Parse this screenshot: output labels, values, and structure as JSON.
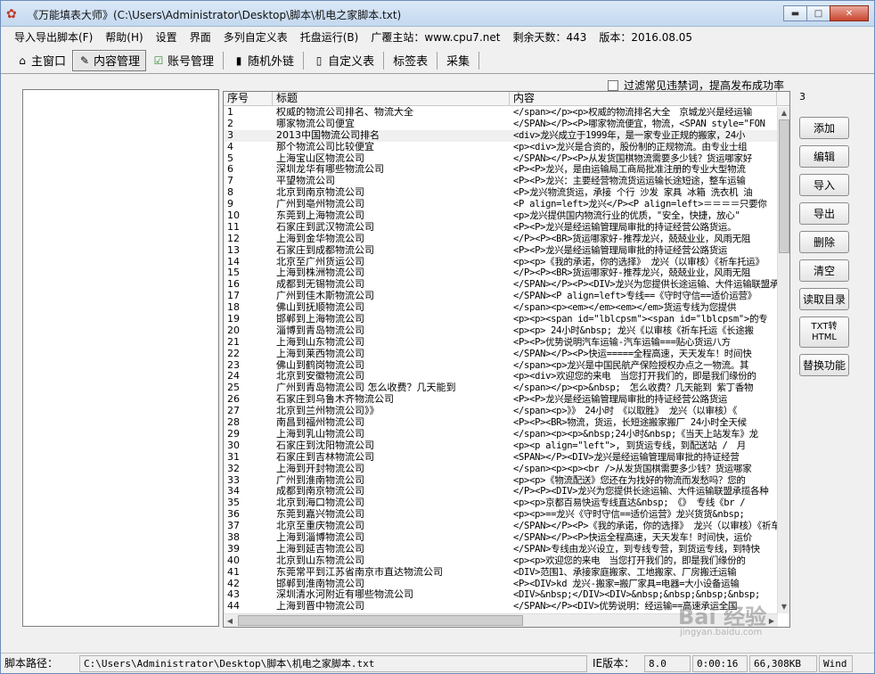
{
  "window": {
    "title": "《万能填表大师》(C:\\Users\\Administrator\\Desktop\\脚本\\机电之家脚本.txt)"
  },
  "menu": [
    "导入导出脚本(F)",
    "帮助(H)",
    "设置",
    "界面",
    "多列自定义表",
    "托盘运行(B)",
    "广覆主站：www.cpu7.net",
    "剩余天数：443",
    "版本：2016.08.05"
  ],
  "tabs": [
    {
      "label": "主窗口",
      "icon": "home-icon"
    },
    {
      "label": "内容管理",
      "icon": "notepad-icon",
      "active": true
    },
    {
      "label": "账号管理",
      "icon": "check-icon"
    },
    {
      "label": "随机外链",
      "icon": "link-icon"
    },
    {
      "label": "自定义表",
      "icon": "book-icon"
    },
    {
      "label": "标签表",
      "icon": ""
    },
    {
      "label": "采集",
      "icon": ""
    }
  ],
  "filter": {
    "label": "过滤常见违禁词，提高发布成功率",
    "checked": false
  },
  "count": "3",
  "table": {
    "headers": [
      "序号",
      "标题",
      "内容"
    ],
    "rows": [
      [
        "1",
        "权威的物流公司排名、物流大全",
        "</span></p><p>权威的物流排名大全　京城龙兴是经运输"
      ],
      [
        "2",
        "哪家物流公司便宜",
        "</SPAN></P><P>哪家物流便宜，物流，<SPAN style=\"FON"
      ],
      [
        "3",
        "2013中国物流公司排名",
        "<div>龙兴成立于1999年，是一家专业正规的搬家，24小"
      ],
      [
        "4",
        "那个物流公司比较便宜",
        "<p><div>龙兴是合资的，股份制的正规物流。由专业士组"
      ],
      [
        "5",
        "上海宝山区物流公司",
        "</SPAN></P><P>从发货国棋物流需要多少钱？货运哪家好"
      ],
      [
        "6",
        "深圳龙华有哪些物流公司",
        "<P><P>龙兴，是由运输局工商局批准注册的专业大型物流"
      ],
      [
        "7",
        "平望物流公司",
        "<P><P>龙兴：主要经营物流货运运输长途短途，整车运输"
      ],
      [
        "8",
        "北京到南京物流公司",
        "<P>龙兴物流货运，承接 个行 沙发 家具 冰箱 洗衣机 油"
      ],
      [
        "9",
        "广州到亳州物流公司",
        "<P align=left>龙兴</P><P align=left>＝＝＝＝只要你"
      ],
      [
        "10",
        "东莞到上海物流公司",
        "<p>龙兴提供国内物流行业的优质，\"安全，快捷，放心\""
      ],
      [
        "11",
        "石家庄到武汉物流公司",
        "<P><P>龙兴是经运输管理局审批的持证经营公路货运。"
      ],
      [
        "12",
        "上海到金华物流公司",
        "</P><P><BR>货运哪家好-推荐龙兴，兢兢业业，风雨无阻"
      ],
      [
        "13",
        "石家庄到成都物流公司",
        "<P><P>龙兴是经运输管理局审批的持证经营公路货运"
      ],
      [
        "14",
        "北京至广州货运公司",
        "<p><p>《我的承诺，你的选择》 龙兴（以审核）《祈车托运》"
      ],
      [
        "15",
        "上海到株洲物流公司",
        "</P><P><BR>货运哪家好-推荐龙兴，兢兢业业，风雨无阻"
      ],
      [
        "16",
        "成都到无锡物流公司",
        "</SPAN></P><P><DIV>龙兴为您提供长途运输、大件运输联盟承揽各种"
      ],
      [
        "17",
        "广州到佳木斯物流公司",
        "</SPAN><P align=left>专线==《守时守信==适价运营》"
      ],
      [
        "18",
        "佛山到抚顺物流公司",
        "</span><p><em></em><em></em>货运专线为您提供"
      ],
      [
        "19",
        "邯郸到上海物流公司",
        "<p><p><span id=\"lblcpsm\"><span id=\"lblcpsm\">的专"
      ],
      [
        "20",
        "淄博到青岛物流公司",
        "<p><p> 24小时&nbsp; 龙兴《以审核《祈车托运《长途搬"
      ],
      [
        "21",
        "上海到山东物流公司",
        "<P><P>优势说明汽车运输-汽车运输===贴心货运八方"
      ],
      [
        "22",
        "上海到莱西物流公司",
        "</SPAN></P><P>快运=====全程高速，天天发车！时间快"
      ],
      [
        "23",
        "佛山到鹤岗物流公司",
        "</span><p>龙兴是中国民航产保险授权办点之一物流。其"
      ],
      [
        "24",
        "北京到安徽物流公司",
        "<p><div>欢迎您的来电　当您打开我们的，即是我们缘份的"
      ],
      [
        "25",
        "广州到青岛物流公司 怎么收费？几天能到",
        "</span></p><p>&nbsp;　怎么收费？几天能到 紫丁香物"
      ],
      [
        "26",
        "石家庄到乌鲁木齐物流公司",
        "<P><P>龙兴是经运输管理局审批的持证经营公路货运"
      ],
      [
        "27",
        "北京到兰州物流公司》》",
        "</span><p>》》　24小时　《以取胜》 龙兴（以审核）《"
      ],
      [
        "28",
        "南昌到福州物流公司",
        "<P><P><BR>物流，货运，长短途搬家搬厂 24小时全天候"
      ],
      [
        "29",
        "上海到乳山物流公司",
        "</span><p><p>&nbsp;24小时&nbsp;《当天上站发车》龙"
      ],
      [
        "30",
        "石家庄到沈阳物流公司",
        "<p><p align=\"left\">, 到货运专线，到配送站 /　月"
      ],
      [
        "31",
        "石家庄到吉林物流公司",
        "<SPAN></P><DIV>龙兴是经运输管理局审批的持证经营"
      ],
      [
        "32",
        "上海到开封物流公司",
        "</span><p><p><br />从发货国棋需要多少钱？货运哪家"
      ],
      [
        "33",
        "广州到淮南物流公司",
        "<p><p>《物流配送》您还在为找好的物流而发愁吗？您的"
      ],
      [
        "34",
        "成都到南京物流公司",
        "</P><P><DIV>龙兴为您提供长途运输、大件运输联盟承揽各种"
      ],
      [
        "35",
        "北京到海口物流公司",
        "<p><p>京都百易快运专线直达&nbsp;　《》 专线《br /"
      ],
      [
        "36",
        "东莞到嘉兴物流公司",
        "<p><p>==龙兴《守时守信==适价运营》龙兴货货&nbsp;"
      ],
      [
        "37",
        "北京至重庆物流公司",
        "</SPAN></P><P>《我的承诺，你的选择》 龙兴（以审核）《祈车"
      ],
      [
        "38",
        "上海到淄博物流公司",
        "</SPAN></P><P>快运全程高速，天天发车！时间快，运价"
      ],
      [
        "39",
        "上海到延吉物流公司",
        "</SPAN>专线由龙兴设立，到专线专营，到货运专线，到特快"
      ],
      [
        "40",
        "北京到山东物流公司",
        "<p><p>欢迎您的来电　当您打开我们的，即是我们缘份的"
      ],
      [
        "41",
        "东莞常平到江苏省南京市直达物流公司",
        "<DIV>范围1、承接家庭搬家、工地搬家、厂房搬迁运输"
      ],
      [
        "42",
        "邯郸到淮南物流公司",
        "<P><DIV>kd 龙兴-搬家=搬厂家具=电器=大小设备运输"
      ],
      [
        "43",
        "深圳清水河附近有哪些物流公司",
        "<DIV>&nbsp;</DIV><DIV>&nbsp;&nbsp;&nbsp;&nbsp;"
      ],
      [
        "44",
        "上海到晋中物流公司",
        "</SPAN></P><DIV>优势说明：经运输==高速承运全国"
      ]
    ]
  },
  "buttons": [
    "添加",
    "编辑",
    "导入",
    "导出",
    "删除",
    "清空",
    "读取目录",
    "TXT转 HTML",
    "替换功能"
  ],
  "status": {
    "path_label": "脚本路径：",
    "path": "C:\\Users\\Administrator\\Desktop\\脚本\\机电之家脚本.txt",
    "ie_label": "IE版本：",
    "ie_version": "8.0",
    "timer": "0:00:16",
    "memory": "66,308KB",
    "os": "Wind"
  },
  "watermark": {
    "main": "Bai 经验",
    "sub": "jingyan.baidu.com"
  }
}
